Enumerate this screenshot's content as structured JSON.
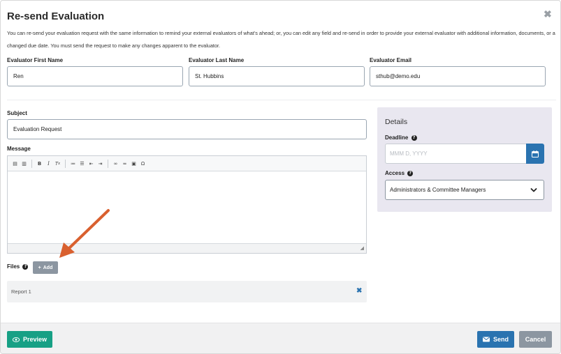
{
  "modal": {
    "title": "Re-send Evaluation",
    "intro": "You can re-send your evaluation request with the same information to remind your external evaluators of what's ahead; or, you can edit any field and re-send in order to provide your external evaluator with additional information, documents, or a changed due date. You must send the request to make any changes apparent to the evaluator."
  },
  "evaluator": {
    "first_name_label": "Evaluator First Name",
    "first_name_value": "Ren",
    "last_name_label": "Evaluator Last Name",
    "last_name_value": "St. Hubbins",
    "email_label": "Evaluator Email",
    "email_value": "sthub@demo.edu"
  },
  "subject": {
    "label": "Subject",
    "value": "Evaluation Request"
  },
  "message": {
    "label": "Message",
    "value": ""
  },
  "files": {
    "label": "Files",
    "add_label": "Add",
    "items": [
      {
        "name": "Report 1"
      }
    ]
  },
  "details": {
    "title": "Details",
    "deadline_label": "Deadline",
    "deadline_placeholder": "MMM D, YYYY",
    "access_label": "Access",
    "access_value": "Administrators & Committee Managers"
  },
  "footer": {
    "preview_label": "Preview",
    "send_label": "Send",
    "cancel_label": "Cancel"
  },
  "colors": {
    "primary": "#2a73b0",
    "success": "#17a085",
    "muted": "#8c96a1",
    "annotation_arrow": "#d9602f"
  }
}
